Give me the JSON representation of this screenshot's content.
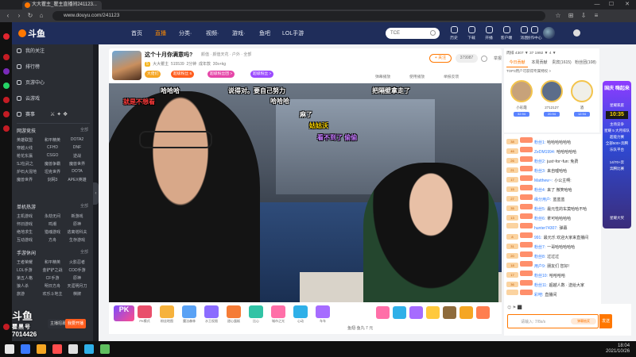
{
  "browser": {
    "tab_title": "大大瞿主_瞿主直播间241123...",
    "url": "www.douyu.com/241123",
    "min": "—",
    "max": "☐",
    "close": "✕"
  },
  "header": {
    "logo": "斗鱼",
    "nav": [
      "首页",
      "直播",
      "分类·",
      "视频·",
      "游戏·",
      "鱼吧",
      "LOL手游"
    ],
    "search_placeholder": "TCE",
    "items": [
      "历史",
      "下载",
      "开播",
      "客户端",
      "消息",
      "创作中心"
    ]
  },
  "sidebar": {
    "menu": [
      "我的关注",
      "排行榜",
      "页游中心",
      "云游戏",
      "赛事"
    ],
    "sections": [
      {
        "title": "网游竞技",
        "more": "全部",
        "cells": [
          "英雄联盟",
          "和平精英",
          "DOTA2",
          "穿越火线",
          "CFHD",
          "DNF",
          "枪花东瀛",
          "CSGO",
          "逆战",
          "SJ在武之",
          "魔兽争霸",
          "魔兽世界",
          "炉石大混地",
          "坦克世界",
          "DOTA",
          "魔兽世界",
          "剑网3",
          "APEX英雄"
        ]
      },
      {
        "title": "单机热游",
        "more": "全部",
        "cells": [
          "主机游戏",
          "永劫无间",
          "新游戏",
          "怀旧游戏",
          "鸣潮",
          "原神",
          "绝地求生",
          "猎魂游戏",
          "逃离塔科夫",
          "互动游戏",
          "方舟",
          "生存游戏"
        ]
      },
      {
        "title": "手游休闲",
        "more": "全部",
        "cells": [
          "王者荣耀",
          "和平精英",
          "火影忍者",
          "LOL手游",
          "金铲铲之战",
          "COD手游",
          "第五人格",
          "CF手游",
          "原神",
          "狼人杀",
          "明日方舟",
          "天涯明月刀",
          "旅游",
          "欢乐斗地主",
          "棋牌"
        ]
      }
    ],
    "watermark_logo": "斗鱼",
    "watermark_sub": "瞿黑号",
    "watermark_id": "7014426",
    "bottom_buttons": [
      "主播招募",
      "我要开播"
    ]
  },
  "room": {
    "title": "这个十月你满意吗?",
    "category": "颜值 · 颜值天花 · 户外 · 全部",
    "meta": [
      "大大瞿主",
      "515539",
      "2分钟",
      "成年款",
      "30s+kg"
    ],
    "level": "5",
    "tags": [
      "大佬们",
      "超级粉丝 5",
      "超级粉丝团 >",
      "超级粉丝 >"
    ],
    "follow": "+ 关注",
    "follow_count": "379987",
    "report": "举报",
    "tools": [
      "弹幕播放",
      "使用播放",
      "举报反馈"
    ]
  },
  "captions": [
    {
      "text": "就是不想看",
      "color": "red"
    },
    {
      "text": "哈哈哈",
      "color": "white"
    },
    {
      "text": "说得对。要自己努力",
      "color": "white"
    },
    {
      "text": "把隔壁拿走了",
      "color": "white"
    },
    {
      "text": "哈哈哈",
      "color": "white"
    },
    {
      "text": "麻了",
      "color": "white"
    },
    {
      "text": "姑姑沃",
      "color": "yellow"
    },
    {
      "text": "看不到了 偷偷",
      "color": "purple"
    }
  ],
  "gifts": {
    "pk": "PK",
    "labels": [
      "PK模式",
      "粉丝地图",
      "魔法森林",
      "水王权限",
      "甜心蛋糕",
      "比心",
      "城市之光",
      "心动",
      "车车"
    ],
    "bottom_text": "鱼翅·鱼丸 7 元",
    "colors": [
      "#e94f6b",
      "#f6b23c",
      "#5aa2f5",
      "#8b6cff",
      "#f57c36",
      "#31c3a5",
      "#ff6fa8",
      "#2fb0e8",
      "#a66cff",
      "#ffc93c",
      "#8e6b3b",
      "#f5a623",
      "#ff7e4f"
    ]
  },
  "rank": {
    "top": "周排 4307 ▼ 37 1992 ▼ 4 ▼",
    "tabs": [
      "今日贡献",
      "本周贡献",
      "贵宾(1615)",
      "粉丝团(108)"
    ],
    "sub": "TOP3用户可获得专属特权 >",
    "users": [
      {
        "name": "小彩霞",
        "score": "32.94"
      },
      {
        "name": "2712127",
        "score": "20.94"
      },
      {
        "name": "酒",
        "score": "12.94"
      }
    ]
  },
  "activity": {
    "title": "国庆 嗨起来",
    "subtitle": "星耀家庭",
    "clock": "10:35",
    "lines": [
      "主场竞争",
      "星耀 5 大月排队",
      "超能力赛",
      "全部500+奔腾",
      "乐队平台",
      "14/70+奔",
      "奔腾比赛",
      "星耀大奖"
    ]
  },
  "chat": {
    "messages": [
      {
        "level": "38",
        "nick": "粉丝1:",
        "text": "哈哈哈哈哈哈"
      },
      {
        "level": "46",
        "nick": "ZeDM1994:",
        "text": "哈哈哈哈哈"
      },
      {
        "level": "26",
        "nick": "粉丝2:",
        "text": "just~for~fun: 免费"
      },
      {
        "level": "21",
        "nick": "粉丝3:",
        "text": "来自嘘哈哈"
      },
      {
        "level": "17",
        "nick": "Matthew~:",
        "text": "小公主啊:"
      },
      {
        "level": "15",
        "nick": "粉丝4:",
        "text": "来了 微笑哈哈"
      },
      {
        "level": "27",
        "nick": "缘分用户:",
        "text": "蓝蓝蓝"
      },
      {
        "level": "35",
        "nick": "粉丝5:",
        "text": "最元性的车莫哈哈不哈"
      },
      {
        "level": "13",
        "nick": "粉丝6:",
        "text": "拿可哈哈哈哈"
      },
      {
        "level": "",
        "nick": "hunter74307:",
        "text": "弹幕"
      },
      {
        "level": "8",
        "nick": "991:",
        "text": "最元乐 欢迎大家来直播间"
      },
      {
        "level": "31",
        "nick": "粉丝7:",
        "text": "一哥哈哈哈哈哈"
      },
      {
        "level": "20",
        "nick": "粉丝8:",
        "text": "过过过"
      },
      {
        "level": "18",
        "nick": "用户9:",
        "text": "朋友们 您好!"
      },
      {
        "level": "17",
        "nick": "粉丝10:",
        "text": "哈哈哈哈"
      },
      {
        "level": "36",
        "nick": "粉丝11:",
        "text": "超越人数 · 送给大家"
      },
      {
        "level": "",
        "nick": "彩吧:",
        "text": "直播间"
      }
    ],
    "icons": "😊 ⚑ ⬛",
    "placeholder": "请输入: 7/8s/s",
    "send": "发送",
    "extra_btn": "弹幕抽奖"
  },
  "taskbar": {
    "time": "18:04",
    "date": "2021/10/26",
    "icon_colors": [
      "#fff",
      "#3a79ff",
      "#f5a623",
      "#ff4d4d",
      "#e0e0e0",
      "#2fb0e8",
      "#5fbf5f"
    ]
  }
}
